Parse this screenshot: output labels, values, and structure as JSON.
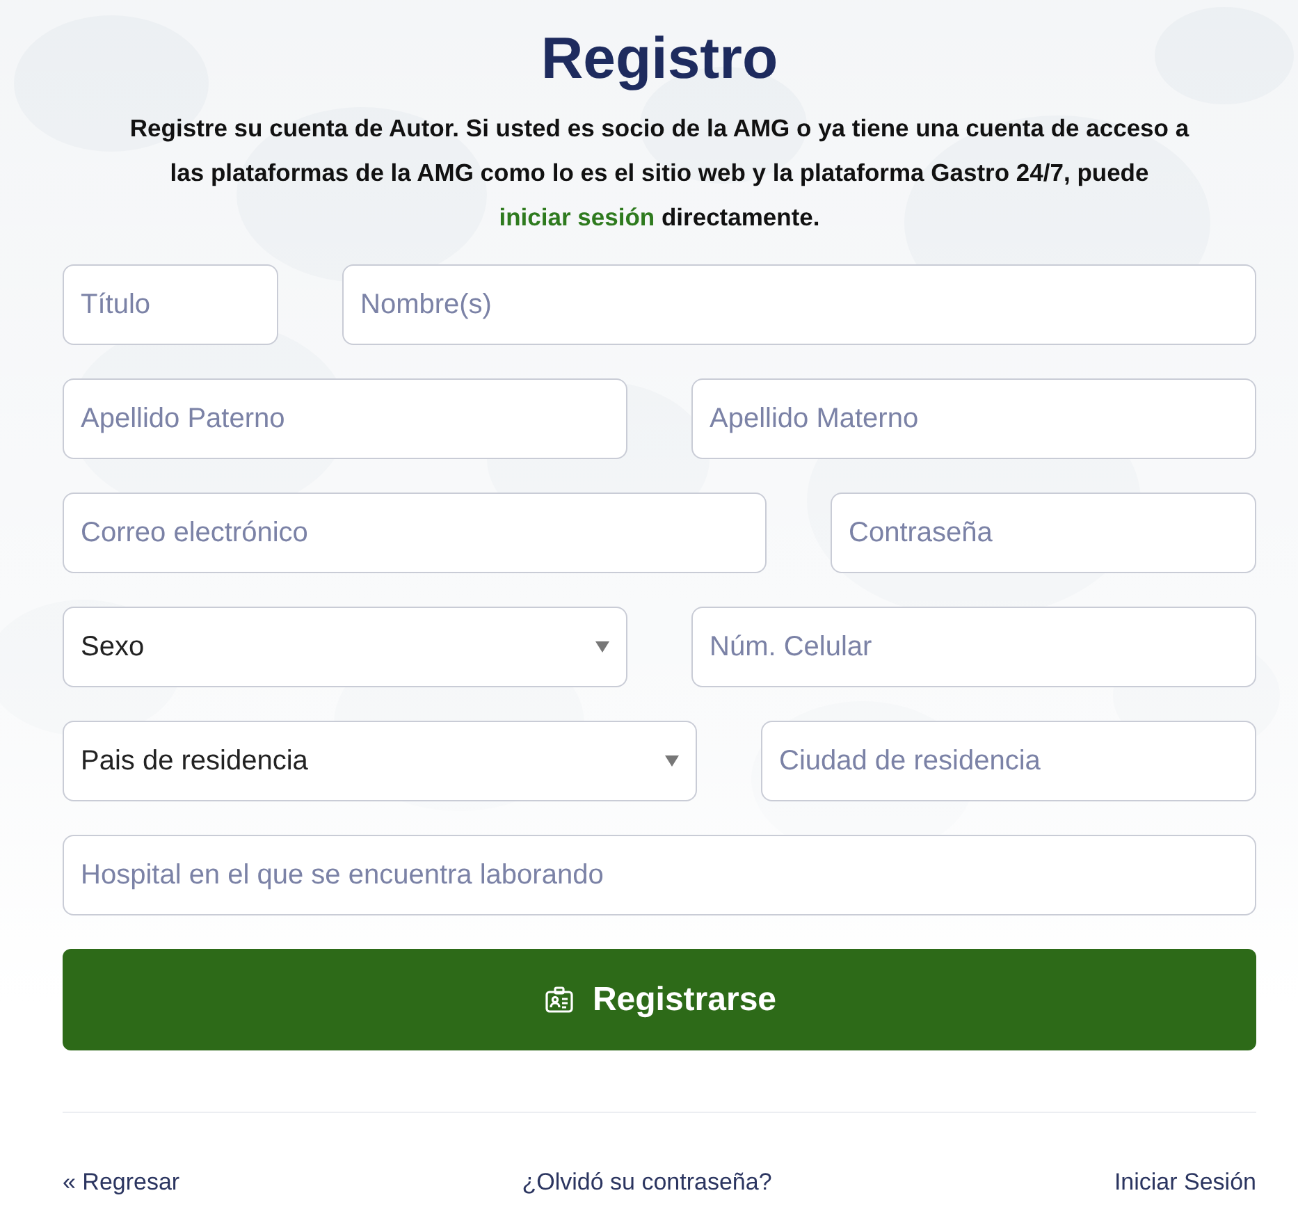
{
  "title": "Registro",
  "intro": {
    "text_before": "Registre su cuenta de Autor. Si usted es socio de la AMG o ya tiene una cuenta de acceso a las plataformas de la AMG como lo es el sitio web y la plataforma Gastro 24/7, puede",
    "link": "iniciar sesión",
    "text_after": "directamente."
  },
  "form_rows": [
    [
      {
        "kind": "input",
        "placeholder": "Título"
      },
      {
        "kind": "input",
        "placeholder": "Nombre(s)"
      }
    ],
    [
      {
        "kind": "input",
        "placeholder": "Apellido Paterno"
      },
      {
        "kind": "input",
        "placeholder": "Apellido Materno"
      }
    ],
    [
      {
        "kind": "input",
        "placeholder": "Correo electrónico"
      },
      {
        "kind": "input",
        "placeholder": "Contraseña"
      }
    ],
    [
      {
        "kind": "select",
        "value": "Sexo"
      },
      {
        "kind": "input",
        "placeholder": "Núm. Celular"
      }
    ],
    [
      {
        "kind": "select",
        "value": "Pais de residencia"
      },
      {
        "kind": "input",
        "placeholder": "Ciudad de residencia"
      }
    ],
    [
      {
        "kind": "input",
        "placeholder": "Hospital en el que se encuentra laborando"
      }
    ]
  ],
  "submit_button": "Registrarse",
  "footer_links": [
    "« Regresar",
    "¿Olvidó su contraseña?",
    "Iniciar Sesión"
  ]
}
